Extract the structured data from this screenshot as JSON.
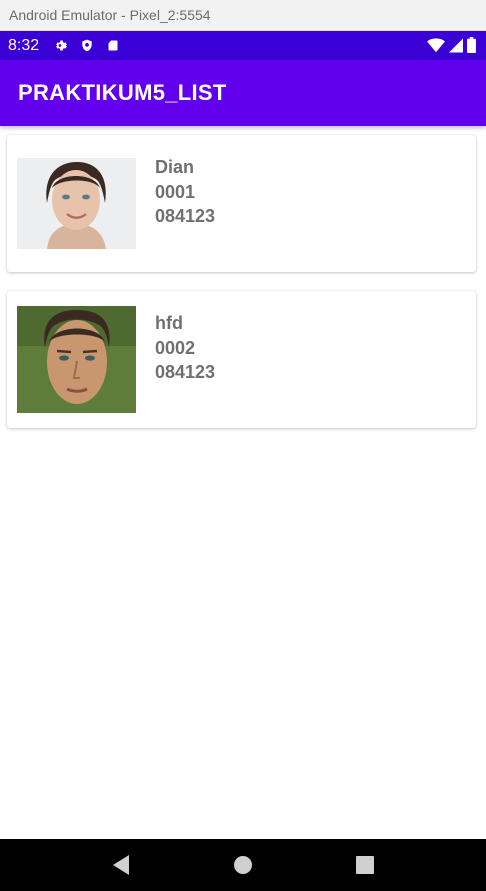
{
  "window": {
    "title": "Android Emulator - Pixel_2:5554"
  },
  "status_bar": {
    "time": "8:32",
    "left_icons": [
      "gear-icon",
      "shield-icon",
      "sd-card-icon"
    ],
    "right_icons": [
      "wifi-icon",
      "signal-icon",
      "battery-icon"
    ]
  },
  "app_bar": {
    "title": "PRAKTIKUM5_LIST",
    "color": "#6200ee",
    "status_color": "#3a00d6"
  },
  "items": [
    {
      "name": "Dian",
      "id": "0001",
      "phone": "084123",
      "photo": "woman-portrait"
    },
    {
      "name": "hfd",
      "id": "0002",
      "phone": "084123",
      "photo": "man-portrait"
    }
  ],
  "nav_bar": {
    "buttons": [
      "back-icon",
      "home-icon",
      "recents-icon"
    ]
  }
}
